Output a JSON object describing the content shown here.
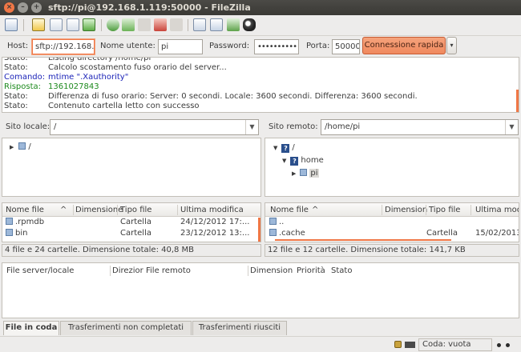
{
  "window": {
    "title": "sftp://pi@192.168.1.119:50000 - FileZilla",
    "buttons": [
      "×",
      "–",
      "+"
    ]
  },
  "toolbar": {
    "icons": [
      "site-manager-icon",
      "toggle-log-icon",
      "toggle-local-tree-icon",
      "toggle-remote-tree-icon",
      "toggle-queue-icon",
      "refresh-icon",
      "process-queue-icon",
      "cancel-icon",
      "disconnect-icon",
      "reconnect-icon",
      "filter-icon",
      "compare-icon",
      "sync-browse-icon",
      "search-icon"
    ]
  },
  "quickconnect": {
    "host_label": "Host:",
    "host_value": "sftp://192.168.",
    "user_label": "Nome utente:",
    "user_value": "pi",
    "pass_label": "Password:",
    "pass_value": "••••••••••",
    "port_label": "Porta:",
    "port_value": "50000",
    "connect_label": "Connessione rapida",
    "dropdown_glyph": "▾"
  },
  "log": [
    {
      "k": "Stato:",
      "v": "Listing directory /home/pi",
      "color": "#3c3c3c"
    },
    {
      "k": "Stato:",
      "v": "Calcolo scostamento fuso orario del server...",
      "color": "#3c3c3c"
    },
    {
      "k": "Comando:",
      "v": "mtime \".Xauthority\"",
      "color": "#1c24b8"
    },
    {
      "k": "Risposta:",
      "v": "1361027843",
      "color": "#1d8a1d"
    },
    {
      "k": "Stato:",
      "v": "Differenza di fuso orario: Server: 0 secondi. Locale: 3600 secondi. Differenza: 3600 secondi.",
      "color": "#3c3c3c"
    },
    {
      "k": "Stato:",
      "v": "Contenuto cartella letto con successo",
      "color": "#3c3c3c"
    }
  ],
  "local": {
    "site_label": "Sito locale:",
    "path": "/",
    "tree_root": "/",
    "columns": [
      "Nome file",
      "Dimensione",
      "Tipo file",
      "Ultima modifica"
    ],
    "sort_glyph": "^",
    "rows": [
      {
        "name": ".rpmdb",
        "size": "",
        "type": "Cartella",
        "modified": "24/12/2012 17:..."
      },
      {
        "name": "bin",
        "size": "",
        "type": "Cartella",
        "modified": "23/12/2012 13:..."
      }
    ],
    "status": "4 file e 24 cartelle. Dimensione totale: 40,8 MB"
  },
  "remote": {
    "site_label": "Sito remoto:",
    "path": "/home/pi",
    "tree": [
      "/",
      "home",
      "pi"
    ],
    "columns": [
      "Nome file",
      "Dimension",
      "Tipo file",
      "Ultima modi"
    ],
    "sort_glyph": "^",
    "rows": [
      {
        "name": "..",
        "size": "",
        "type": "",
        "modified": ""
      },
      {
        "name": ".cache",
        "size": "",
        "type": "Cartella",
        "modified": "15/02/2013 ..."
      }
    ],
    "status": "12 file e 12 cartelle. Dimensione totale: 141,7 KB"
  },
  "queue": {
    "columns": [
      "File server/locale",
      "Direzior",
      "File remoto",
      "Dimension",
      "Priorità",
      "Stato"
    ]
  },
  "tabs": [
    "File in coda",
    "Trasferimenti non completati",
    "Trasferimenti riusciti"
  ],
  "statusbar": {
    "queue_label": "Coda: vuota"
  },
  "colors": {
    "accent": "#f07746",
    "status_text": "#3c3c3c",
    "command_text": "#1c24b8",
    "response_text": "#1d8a1d"
  }
}
